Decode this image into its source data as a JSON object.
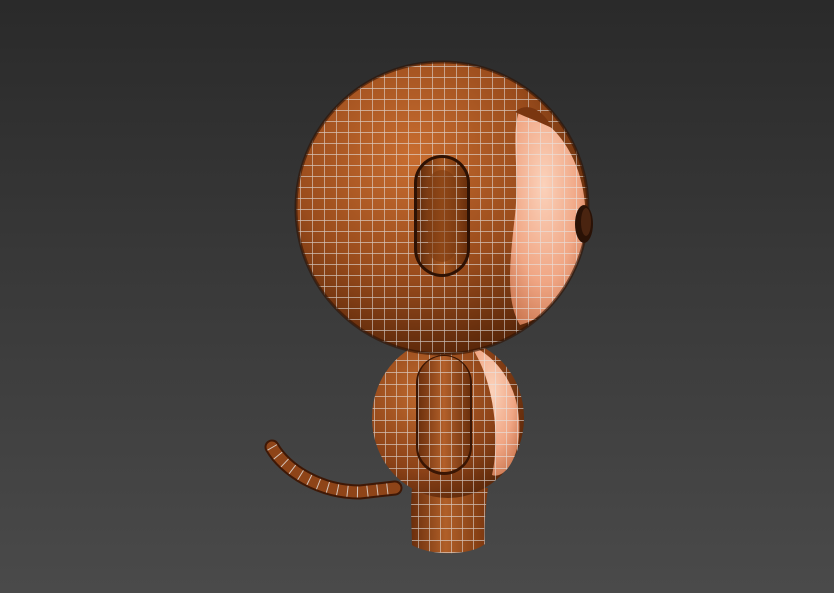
{
  "scene": {
    "subject": "3d-monkey-character-wireframe",
    "colors": {
      "background_top": "#2a2a2a",
      "background_bottom": "#4a4a4a",
      "fur_light": "#b5612a",
      "fur_mid": "#8e4418",
      "fur_dark": "#5a2608",
      "skin_light": "#f6c2a6",
      "skin_mid": "#e8946e",
      "wire": "#e6e6e6",
      "eye": "#2a1206"
    }
  }
}
